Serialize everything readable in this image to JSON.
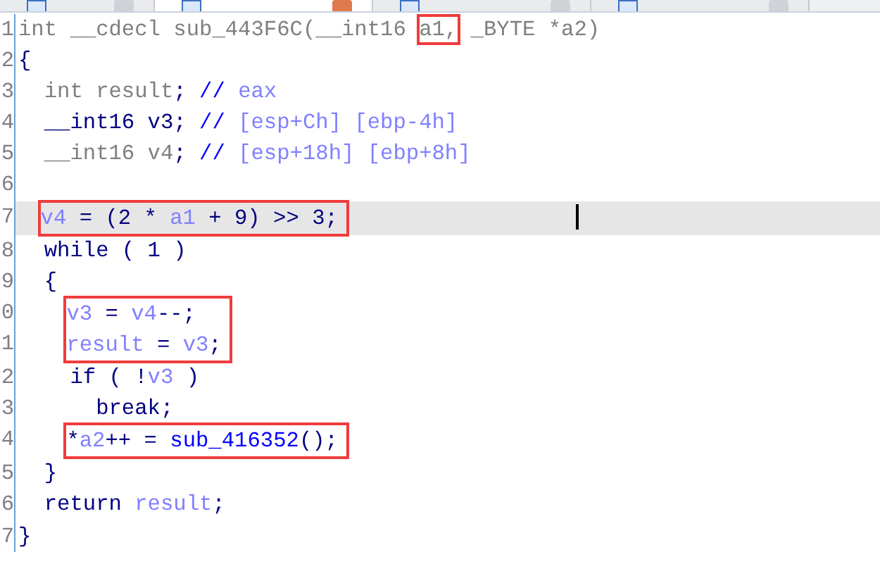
{
  "tabs": [
    {
      "selected": false
    },
    {
      "selected": true
    },
    {
      "selected": false
    },
    {
      "selected": false
    }
  ],
  "code": [
    {
      "kind": "line",
      "number": "1",
      "tokens": [
        {
          "kind": "dim",
          "text": "int __cdecl sub_443F6C("
        },
        {
          "kind": "dim",
          "text": "__int16 "
        },
        {
          "kind": "dim",
          "text": "a1,",
          "boxed": true
        },
        {
          "kind": "dim",
          "text": " _BYTE *a2)"
        }
      ]
    },
    {
      "kind": "line",
      "number": "2",
      "tokens": [
        {
          "kind": "plain",
          "text": "{"
        }
      ],
      "children": [
        {
          "kind": "line",
          "number": "3",
          "tokens": [
            {
              "kind": "dim",
              "text": "int result"
            },
            {
              "kind": "plain",
              "text": "; "
            },
            {
              "kind": "comment",
              "text": "// "
            },
            {
              "kind": "var",
              "text": "eax"
            }
          ]
        },
        {
          "kind": "line",
          "number": "4",
          "tokens": [
            {
              "kind": "plain",
              "text": "__int16 v3; "
            },
            {
              "kind": "comment",
              "text": "// "
            },
            {
              "kind": "var",
              "text": "[esp+Ch] [ebp-4h]"
            }
          ]
        },
        {
          "kind": "line",
          "number": "5",
          "tokens": [
            {
              "kind": "dim",
              "text": "__int16 v4"
            },
            {
              "kind": "plain",
              "text": "; "
            },
            {
              "kind": "comment",
              "text": "// "
            },
            {
              "kind": "var",
              "text": "[esp+18h] [ebp+8h]"
            }
          ]
        },
        {
          "kind": "line",
          "number": "6"
        },
        {
          "kind": "boxed",
          "lines": [
            {
              "number": "7",
              "selected": true,
              "tokens": [
                {
                  "kind": "var",
                  "text": "v4"
                },
                {
                  "kind": "plain",
                  "text": " = (2 * "
                },
                {
                  "kind": "var",
                  "text": "a1"
                },
                {
                  "kind": "plain",
                  "text": " + 9) >> 3;"
                }
              ]
            }
          ]
        },
        {
          "kind": "line",
          "number": "8",
          "tokens": [
            {
              "kind": "plain",
              "text": "while ( 1 )"
            }
          ]
        },
        {
          "kind": "line",
          "number": "9",
          "tokens": [
            {
              "kind": "plain",
              "text": "{"
            }
          ],
          "children": [
            {
              "kind": "boxed",
              "lines": [
                {
                  "number": "0",
                  "selected": false,
                  "tokens": [
                    {
                      "kind": "var",
                      "text": "v3"
                    },
                    {
                      "kind": "plain",
                      "text": " = "
                    },
                    {
                      "kind": "var",
                      "text": "v4"
                    },
                    {
                      "kind": "plain",
                      "text": "--;"
                    }
                  ]
                },
                {
                  "number": "1",
                  "selected": false,
                  "tokens": [
                    {
                      "kind": "var",
                      "text": "result"
                    },
                    {
                      "kind": "plain",
                      "text": " = "
                    },
                    {
                      "kind": "var",
                      "text": "v3"
                    },
                    {
                      "kind": "plain",
                      "text": ";"
                    }
                  ]
                }
              ]
            },
            {
              "kind": "line",
              "number": "2",
              "tokens": [
                {
                  "kind": "plain",
                  "text": "if ( !"
                },
                {
                  "kind": "var",
                  "text": "v3"
                },
                {
                  "kind": "plain",
                  "text": " )"
                }
              ],
              "children": [
                {
                  "kind": "line",
                  "number": "3",
                  "tokens": [
                    {
                      "kind": "plain",
                      "text": "break;"
                    }
                  ]
                }
              ]
            },
            {
              "kind": "boxed",
              "lines": [
                {
                  "number": "4",
                  "selected": false,
                  "tokens": [
                    {
                      "kind": "plain",
                      "text": "*"
                    },
                    {
                      "kind": "var",
                      "text": "a2"
                    },
                    {
                      "kind": "plain",
                      "text": "++ = "
                    },
                    {
                      "kind": "func",
                      "text": "sub_416352"
                    },
                    {
                      "kind": "plain",
                      "text": "();"
                    }
                  ]
                }
              ]
            }
          ]
        },
        {
          "kind": "line",
          "number": "5",
          "tokens": [
            {
              "kind": "plain",
              "text": "}"
            }
          ]
        },
        {
          "kind": "line",
          "number": "6",
          "tokens": [
            {
              "kind": "plain",
              "text": "return "
            },
            {
              "kind": "var",
              "text": "result"
            },
            {
              "kind": "plain",
              "text": ";"
            }
          ]
        }
      ]
    },
    {
      "kind": "line",
      "number": "7",
      "tokens": [
        {
          "kind": "plain",
          "text": "}"
        }
      ]
    }
  ]
}
